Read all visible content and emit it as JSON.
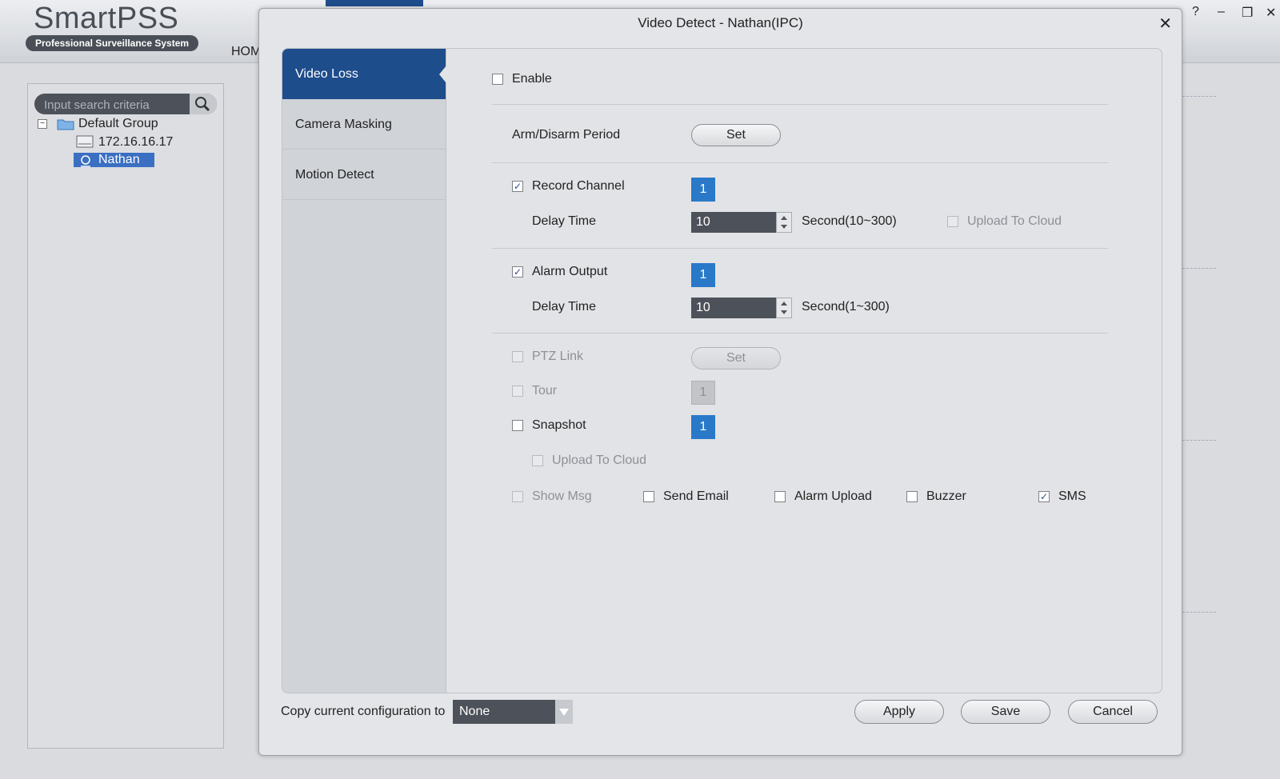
{
  "app": {
    "logo_main": "SmartPSS",
    "logo_sub": "Professional Surveillance System",
    "home_tab": "HOM",
    "window_controls": [
      "?",
      "–",
      "❐",
      "✕"
    ]
  },
  "device_panel": {
    "search_placeholder": "Input search criteria",
    "tree": {
      "group": "Default Group",
      "device": "172.16.16.17",
      "selected_device": "Nathan"
    }
  },
  "dialog": {
    "title": "Video Detect - Nathan(IPC)",
    "nav": [
      "Video Loss",
      "Camera Masking",
      "Motion Detect"
    ],
    "active_nav": "Video Loss",
    "enable_label": "Enable",
    "enable_checked": false,
    "arm_period_label": "Arm/Disarm Period",
    "set_label": "Set",
    "record_channel": {
      "label": "Record Channel",
      "checked": true,
      "channel": "1",
      "delay_label": "Delay Time",
      "delay_value": "10",
      "delay_range": "Second(10~300)",
      "upload_label": "Upload To Cloud",
      "upload_checked": false
    },
    "alarm_output": {
      "label": "Alarm Output",
      "checked": true,
      "channel": "1",
      "delay_label": "Delay Time",
      "delay_value": "10",
      "delay_range": "Second(1~300)"
    },
    "ptz_link": {
      "label": "PTZ Link",
      "checked": false,
      "button": "Set"
    },
    "tour": {
      "label": "Tour",
      "checked": false,
      "channel": "1"
    },
    "snapshot": {
      "label": "Snapshot",
      "checked": false,
      "channel": "1",
      "upload_label": "Upload To Cloud",
      "upload_checked": false
    },
    "options": {
      "show_msg": {
        "label": "Show Msg",
        "checked": false
      },
      "send_email": {
        "label": "Send Email",
        "checked": false
      },
      "alarm_upload": {
        "label": "Alarm Upload",
        "checked": false
      },
      "buzzer": {
        "label": "Buzzer",
        "checked": false
      },
      "sms": {
        "label": "SMS",
        "checked": true
      }
    },
    "footer": {
      "copy_label": "Copy current configuration to",
      "copy_value": "None",
      "apply": "Apply",
      "save": "Save",
      "cancel": "Cancel"
    },
    "colors": {
      "accent": "#1e4d8c",
      "channel_blue": "#2a79c9"
    },
    "check_mark": "✓"
  }
}
